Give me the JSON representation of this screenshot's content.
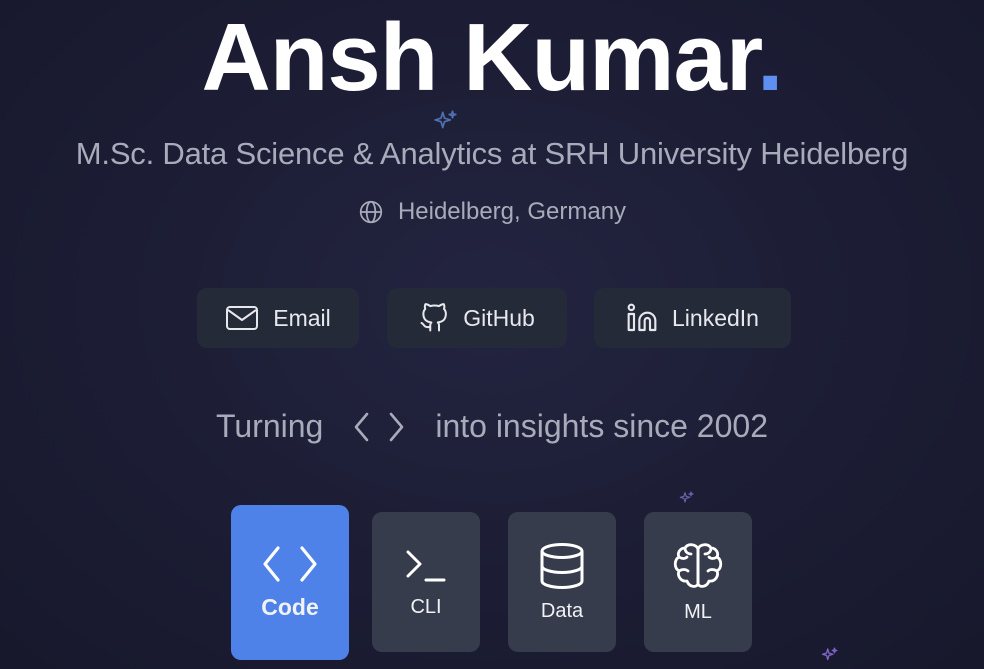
{
  "hero": {
    "name": "Ansh Kumar",
    "name_dot": ".",
    "subtitle": "M.Sc. Data Science & Analytics at SRH University Heidelberg",
    "location": "Heidelberg, Germany",
    "location_icon": "globe-icon"
  },
  "links": [
    {
      "label": "Email",
      "icon": "mail-icon"
    },
    {
      "label": "GitHub",
      "icon": "github-icon"
    },
    {
      "label": "LinkedIn",
      "icon": "linkedin-icon"
    }
  ],
  "tagline": {
    "before": "Turning",
    "icon": "code-brackets-icon",
    "after": "into insights since 2002"
  },
  "tiles": [
    {
      "label": "Code",
      "icon": "code-brackets-icon",
      "active": true
    },
    {
      "label": "CLI",
      "icon": "terminal-icon",
      "active": false
    },
    {
      "label": "Data",
      "icon": "database-icon",
      "active": false
    },
    {
      "label": "ML",
      "icon": "brain-icon",
      "active": false
    }
  ],
  "colors": {
    "background": "#1d1e36",
    "accent": "#5f8ff0",
    "active_tile": "#4f82e8",
    "tile": "#373c4c",
    "link_button": "#252a38",
    "muted_text": "#a7abba"
  }
}
